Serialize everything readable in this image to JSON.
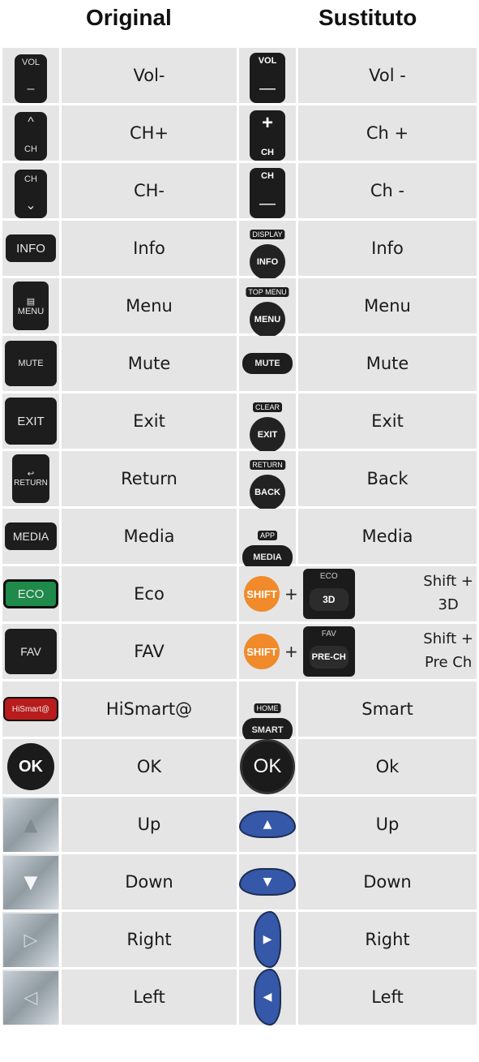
{
  "headers": {
    "original": "Original",
    "substitute": "Sustituto"
  },
  "rows": [
    {
      "orig_icon": "vol-minus-icon",
      "orig_key": {
        "top": "VOL",
        "bottom": "–"
      },
      "orig": "Vol-",
      "sub_icon": "vol-minus-icon",
      "sub_key": {
        "top": "VOL",
        "bottom": "—"
      },
      "sub": "Vol -"
    },
    {
      "orig_icon": "ch-up-icon",
      "orig_key": {
        "top": "^",
        "bottom": "CH"
      },
      "orig": "CH+",
      "sub_icon": "ch-plus-icon",
      "sub_key": {
        "top": "+",
        "bottom": "CH"
      },
      "sub": "Ch +"
    },
    {
      "orig_icon": "ch-down-icon",
      "orig_key": {
        "top": "CH",
        "bottom": "⌄"
      },
      "orig": "CH-",
      "sub_icon": "ch-minus-icon",
      "sub_key": {
        "top": "CH",
        "bottom": "—"
      },
      "sub": "Ch -"
    },
    {
      "orig_icon": "info-icon",
      "orig_key": {
        "label": "INFO"
      },
      "orig": "Info",
      "sub_icon": "display-info-icon",
      "sub_key": {
        "cap": "DISPLAY",
        "label": "INFO"
      },
      "sub": "Info"
    },
    {
      "orig_icon": "menu-icon",
      "orig_key": {
        "label": "▤ MENU"
      },
      "orig": "Menu",
      "sub_icon": "top-menu-icon",
      "sub_key": {
        "cap": "TOP MENU",
        "label": "MENU"
      },
      "sub": "Menu"
    },
    {
      "orig_icon": "mute-icon",
      "orig_key": {
        "label": "MUTE"
      },
      "orig": "Mute",
      "sub_icon": "mute-icon",
      "sub_key": {
        "label": "MUTE"
      },
      "sub": "Mute"
    },
    {
      "orig_icon": "exit-icon",
      "orig_key": {
        "label": "EXIT"
      },
      "orig": "Exit",
      "sub_icon": "clear-exit-icon",
      "sub_key": {
        "cap": "CLEAR",
        "label": "EXIT"
      },
      "sub": "Exit"
    },
    {
      "orig_icon": "return-icon",
      "orig_key": {
        "label": "↩ RETURN"
      },
      "orig": "Return",
      "sub_icon": "return-back-icon",
      "sub_key": {
        "cap": "RETURN",
        "label": "BACK"
      },
      "sub": "Back"
    },
    {
      "orig_icon": "media-icon",
      "orig_key": {
        "label": "MEDIA"
      },
      "orig": "Media",
      "sub_icon": "app-media-icon",
      "sub_key": {
        "cap": "APP",
        "label": "MEDIA"
      },
      "sub": "Media"
    },
    {
      "orig_icon": "eco-icon",
      "orig_key": {
        "label": "ECO"
      },
      "orig": "Eco",
      "sub_icon": "shift-3d-icon",
      "sub_key": {
        "shift": "SHIFT",
        "plus": "+",
        "top": "ECO",
        "label": "3D"
      },
      "sub": "Shift +\n3D"
    },
    {
      "orig_icon": "fav-icon",
      "orig_key": {
        "label": "FAV"
      },
      "orig": "FAV",
      "sub_icon": "shift-pre-ch-icon",
      "sub_key": {
        "shift": "SHIFT",
        "plus": "+",
        "top": "FAV",
        "label": "PRE-CH"
      },
      "sub": "Shift +\nPre Ch"
    },
    {
      "orig_icon": "hismart-icon",
      "orig_key": {
        "label": "HiSmart@"
      },
      "orig": "HiSmart@",
      "sub_icon": "home-smart-icon",
      "sub_key": {
        "cap": "HOME",
        "label": "SMART"
      },
      "sub": "Smart"
    },
    {
      "orig_icon": "ok-icon",
      "orig_key": {
        "label": "OK"
      },
      "orig": "OK",
      "sub_icon": "ok-icon",
      "sub_key": {
        "label": "OK"
      },
      "sub": "Ok"
    },
    {
      "orig_icon": "up-arrow-icon",
      "orig_key": {
        "label": "▲"
      },
      "orig": "Up",
      "sub_icon": "up-arrow-icon",
      "sub_key": {
        "label": "▲"
      },
      "sub": "Up"
    },
    {
      "orig_icon": "down-arrow-icon",
      "orig_key": {
        "label": "▼"
      },
      "orig": "Down",
      "sub_icon": "down-arrow-icon",
      "sub_key": {
        "label": "▼"
      },
      "sub": "Down"
    },
    {
      "orig_icon": "right-arrow-icon",
      "orig_key": {
        "label": "▷"
      },
      "orig": "Right",
      "sub_icon": "right-arrow-icon",
      "sub_key": {
        "label": "▶"
      },
      "sub": "Right"
    },
    {
      "orig_icon": "left-arrow-icon",
      "orig_key": {
        "label": "◁"
      },
      "orig": "Left",
      "sub_icon": "left-arrow-icon",
      "sub_key": {
        "label": "◀"
      },
      "sub": "Left"
    }
  ],
  "colors": {
    "cell_bg": "#e5e5e5",
    "key_dark": "#1d1d1d",
    "shift_orange": "#f08a2a",
    "eco_green": "#1f8a4a",
    "hismart_red": "#b81c1c",
    "dpad_blue": "#3558a8"
  }
}
